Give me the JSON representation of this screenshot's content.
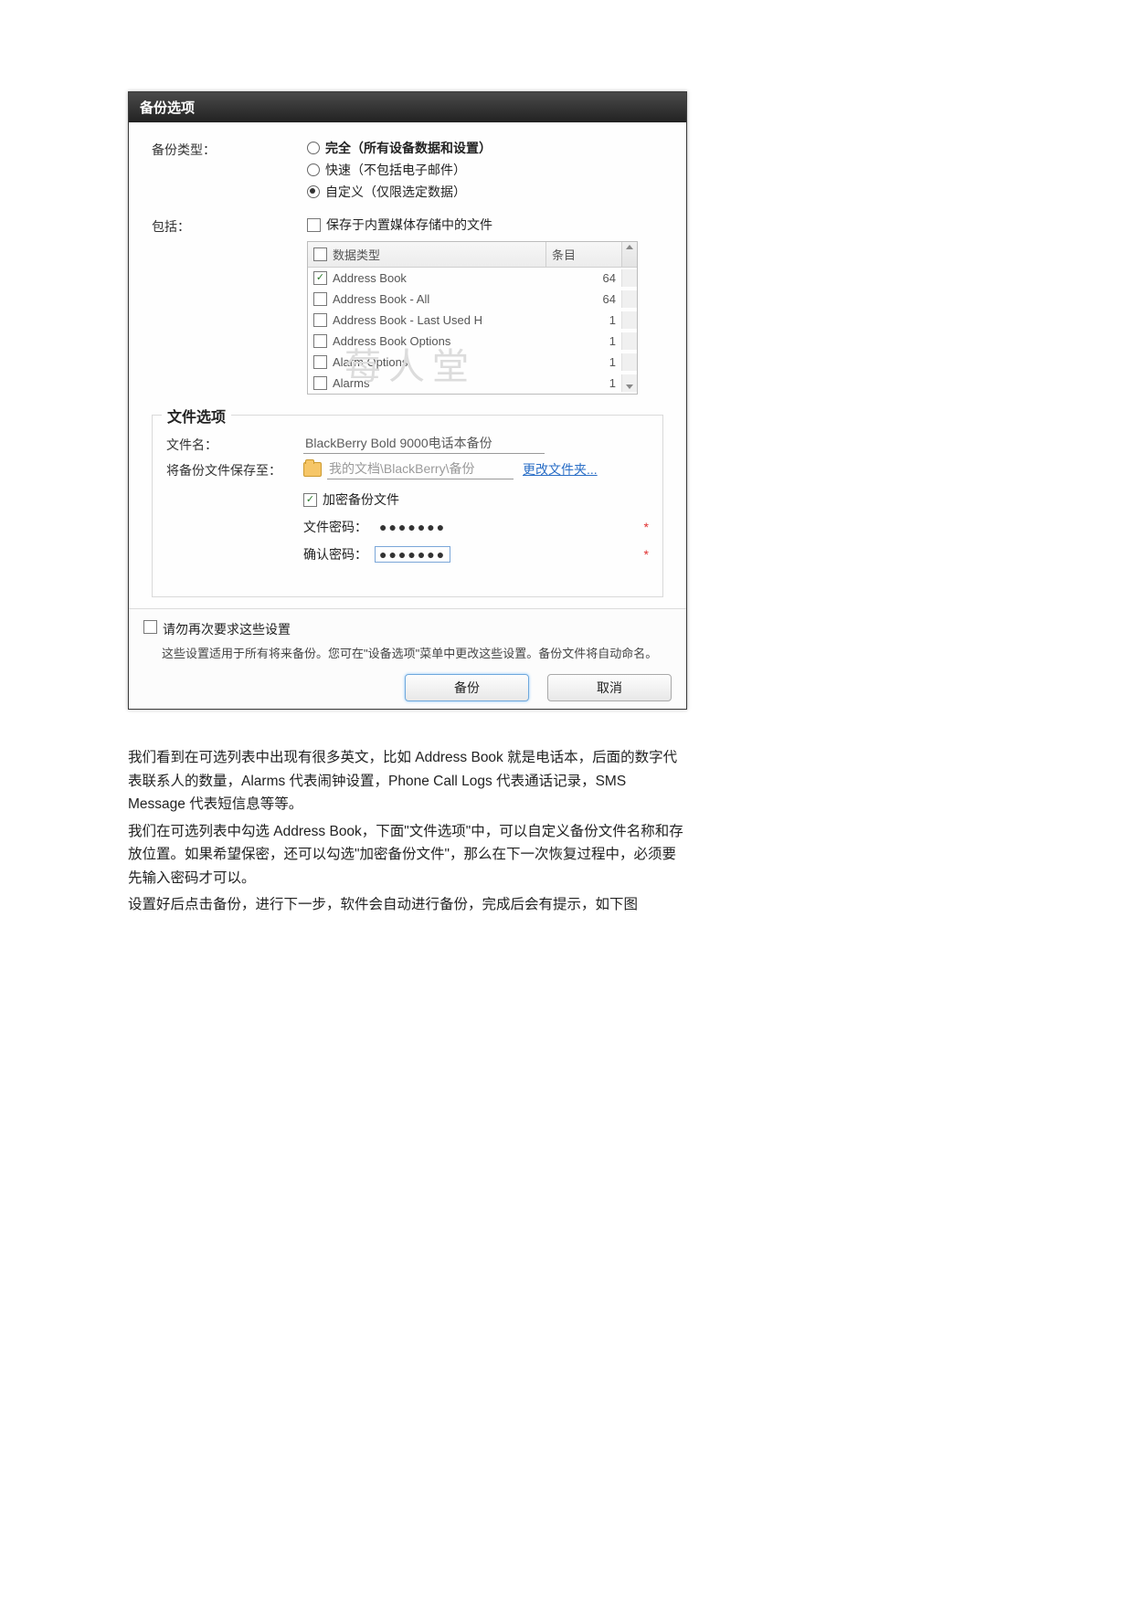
{
  "dialog": {
    "title": "备份选项",
    "backup_type_label": "备份类型：",
    "backup_types": {
      "full": "完全（所有设备数据和设置）",
      "quick": "快速（不包括电子邮件）",
      "custom": "自定义（仅限选定数据）"
    },
    "include_label": "包括：",
    "include_media_checkbox": "保存于内置媒体存储中的文件",
    "grid": {
      "header_name": "数据类型",
      "header_count": "条目",
      "rows": [
        {
          "name": "Address Book",
          "count": "64",
          "checked": true
        },
        {
          "name": "Address Book - All",
          "count": "64",
          "checked": false
        },
        {
          "name": "Address Book - Last Used H",
          "count": "1",
          "checked": false
        },
        {
          "name": "Address Book Options",
          "count": "1",
          "checked": false
        },
        {
          "name": "Alarm Options",
          "count": "1",
          "checked": false
        },
        {
          "name": "Alarms",
          "count": "1",
          "checked": false
        }
      ]
    },
    "file_section": {
      "legend": "文件选项",
      "filename_label": "文件名：",
      "filename_value": "BlackBerry Bold 9000电话本备份",
      "saveto_label": "将备份文件保存至：",
      "saveto_value": "我的文档\\BlackBerry\\备份",
      "change_folder": "更改文件夹...",
      "encrypt_label": "加密备份文件",
      "password_label": "文件密码：",
      "password_value": "●●●●●●●",
      "confirm_label": "确认密码：",
      "confirm_value": "●●●●●●●",
      "required_mark": "*"
    },
    "no_ask_label": "请勿再次要求这些设置",
    "no_ask_hint": "这些设置适用于所有将来备份。您可在\"设备选项\"菜单中更改这些设置。备份文件将自动命名。",
    "buttons": {
      "backup": "备份",
      "cancel": "取消"
    },
    "watermark": "莓人堂"
  },
  "doc": {
    "p1": "我们看到在可选列表中出现有很多英文，比如 Address Book 就是电话本，后面的数字代表联系人的数量，Alarms 代表闹钟设置，Phone Call Logs 代表通话记录，SMS Message 代表短信息等等。",
    "p2": "我们在可选列表中勾选 Address Book，下面\"文件选项\"中，可以自定义备份文件名称和存放位置。如果希望保密，还可以勾选\"加密备份文件\"，那么在下一次恢复过程中，必须要先输入密码才可以。",
    "p3": "设置好后点击备份，进行下一步，软件会自动进行备份，完成后会有提示，如下图"
  }
}
